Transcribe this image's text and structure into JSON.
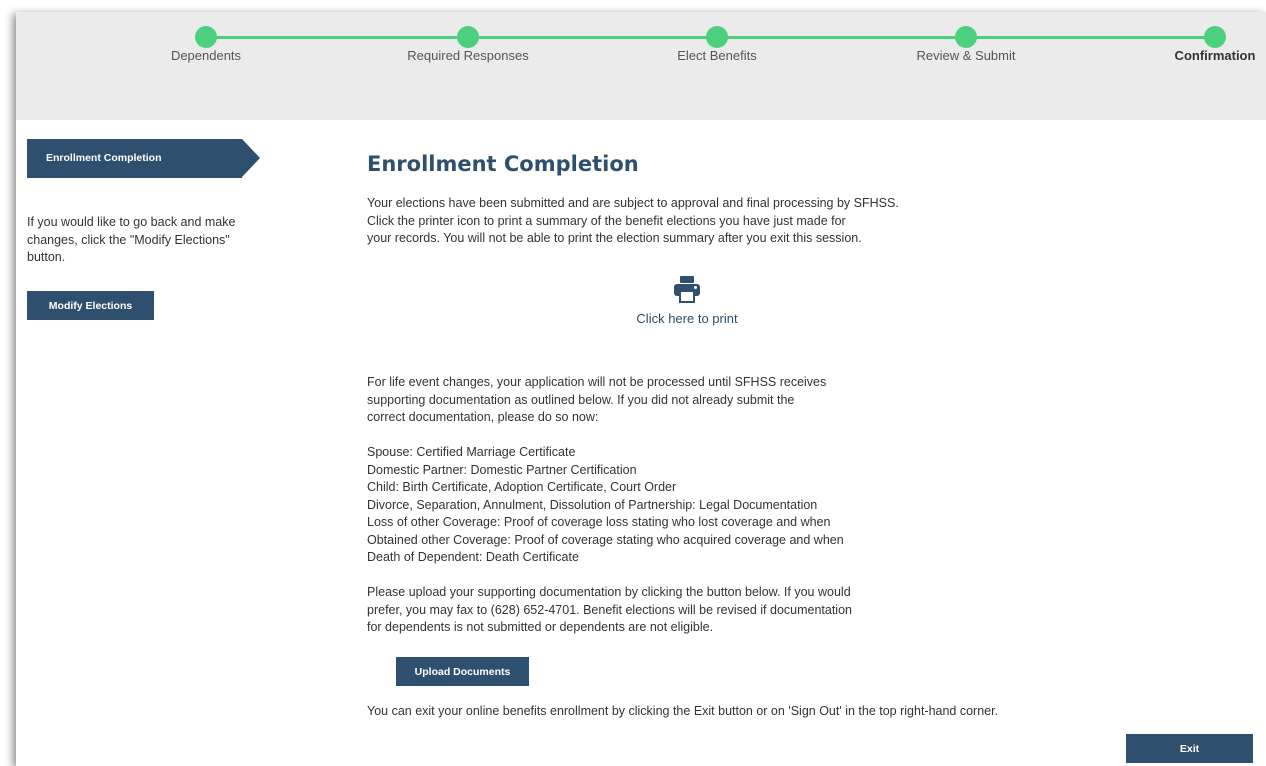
{
  "steps": [
    {
      "label": "Dependents"
    },
    {
      "label": "Required Responses"
    },
    {
      "label": "Elect Benefits"
    },
    {
      "label": "Review & Submit"
    },
    {
      "label": "Confirmation"
    }
  ],
  "sidebar": {
    "tab_label": "Enrollment Completion",
    "help_text": "If you would like to go back and make changes, click the \"Modify Elections\" button.",
    "modify_button": "Modify Elections"
  },
  "main": {
    "title": "Enrollment Completion",
    "intro_lines": [
      "Your elections have been submitted and are subject to approval and final processing by SFHSS.",
      "Click the printer icon to print a summary of the benefit elections you have just made for",
      "your records. You will not be able to print the election summary after you exit this session."
    ],
    "print_label": "Click here to print",
    "life_event_lines": [
      "For life event changes, your application will not be processed until SFHSS receives",
      "supporting documentation as outlined below. If you did not already submit the",
      "correct documentation, please do so now:"
    ],
    "doc_requirements": [
      "Spouse: Certified Marriage Certificate",
      "Domestic Partner: Domestic Partner Certification",
      "Child: Birth Certificate, Adoption Certificate, Court Order",
      "Divorce, Separation, Annulment, Dissolution of Partnership: Legal Documentation",
      "Loss of other Coverage: Proof of coverage loss stating who lost coverage and when",
      "Obtained other Coverage: Proof of coverage stating who acquired coverage and when",
      "Death of Dependent: Death Certificate"
    ],
    "upload_lines": [
      "Please upload your supporting documentation by clicking the button below. If you would",
      "prefer, you may fax to (628) 652-4701. Benefit elections will be revised if documentation",
      "for dependents is not submitted or dependents are not eligible."
    ],
    "upload_button": "Upload Documents",
    "exit_text": "You can exit your online benefits enrollment by clicking the Exit button or on 'Sign Out' in the top right-hand corner.",
    "exit_button": "Exit"
  },
  "colors": {
    "accent": "#2f4f6f",
    "step_green": "#4cd07d",
    "stepper_bg": "#ebebeb"
  }
}
